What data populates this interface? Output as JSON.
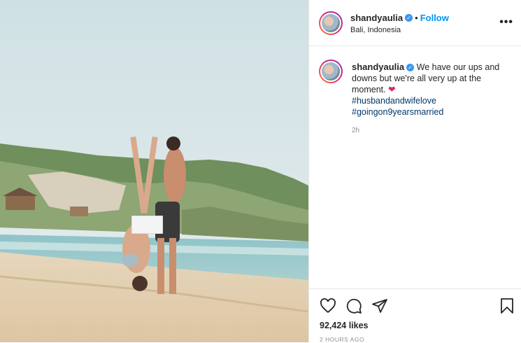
{
  "post": {
    "username": "shandyaulia",
    "verified": true,
    "dot": "•",
    "follow_label": "Follow",
    "location": "Bali, Indonesia",
    "more_icon": "•••"
  },
  "caption": {
    "username": "shandyaulia",
    "text": "We have our ups and downs but we're all very up at the moment.",
    "emoji": "❤",
    "hashtags": [
      "#husbandandwifelove",
      "#goingon9yearsmarried"
    ],
    "time": "2h"
  },
  "actions": {
    "icons": [
      "heart-icon",
      "comment-icon",
      "share-icon",
      "bookmark-icon"
    ],
    "likes": "92,424 likes",
    "posted_ago": "2 HOURS AGO"
  },
  "colors": {
    "follow": "#0095f6",
    "hashtag": "#00376b",
    "heart": "#e0245e",
    "verified": "#3897f0"
  }
}
